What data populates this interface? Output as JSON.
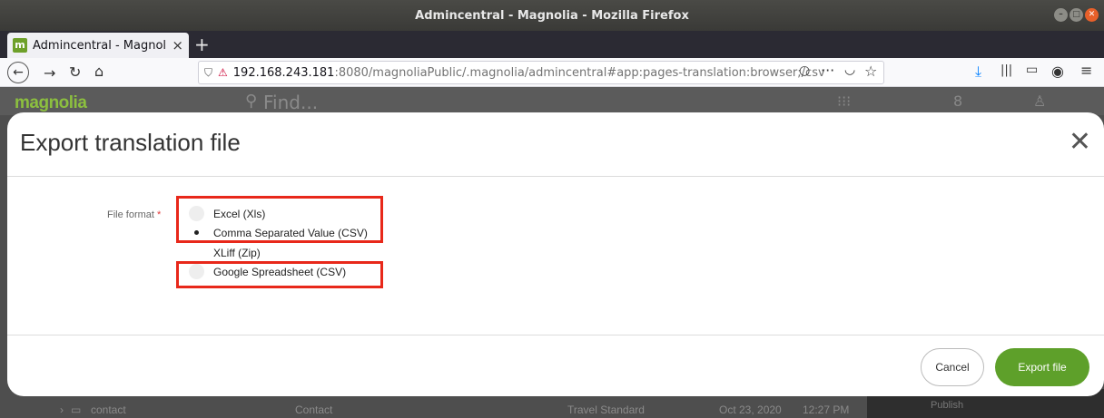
{
  "window": {
    "title": "Admincentral - Magnolia - Mozilla Firefox"
  },
  "browser": {
    "tab_title": "Admincentral - Magnolia",
    "tab_close": "×",
    "new_tab": "+",
    "url_host": "192.168.243.181",
    "url_rest": ":8080/magnoliaPublic/.magnolia/admincentral#app:pages-translation:browser;/csv",
    "nav_icons": {
      "back": "back-arrow-icon",
      "forward": "forward-arrow-icon",
      "reload": "reload-icon",
      "home": "home-icon",
      "downloads": "download-icon",
      "library": "library-icon",
      "sidebar": "sidebar-icon",
      "account": "account-icon",
      "menu": "hamburger-menu-icon"
    }
  },
  "app": {
    "logo": "magnolia",
    "search_placeholder": "Find...",
    "bg_row": {
      "name": "contact",
      "title": "Contact",
      "template": "Travel Standard",
      "date": "Oct 23, 2020",
      "time": "12:27 PM"
    },
    "side_action": "Publish"
  },
  "dialog": {
    "title": "Export translation file",
    "close": "✕",
    "field_label": "File format",
    "required_mark": "*",
    "options": [
      {
        "label": "Excel (Xls)",
        "checked": false
      },
      {
        "label": "Comma Separated Value (CSV)",
        "checked": true
      },
      {
        "label": "XLiff (Zip)",
        "checked": false
      },
      {
        "label": "Google Spreadsheet (CSV)",
        "checked": false
      }
    ],
    "cancel_label": "Cancel",
    "export_label": "Export file"
  },
  "colors": {
    "accent_green": "#5ea02a",
    "highlight_red": "#e8281a",
    "required_red": "#e23a3a"
  }
}
